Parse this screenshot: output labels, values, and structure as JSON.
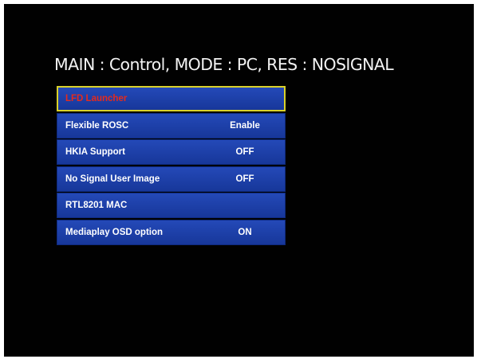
{
  "status": {
    "text": "MAIN : Control, MODE : PC, RES : NOSIGNAL"
  },
  "menu": {
    "items": [
      {
        "label": "LFD Launcher",
        "value": "",
        "selected": true
      },
      {
        "label": "Flexible ROSC",
        "value": "Enable",
        "selected": false
      },
      {
        "label": "HKIA Support",
        "value": "OFF",
        "selected": false
      },
      {
        "label": "No Signal User Image",
        "value": "OFF",
        "selected": false
      },
      {
        "label": "RTL8201 MAC",
        "value": "",
        "selected": false
      },
      {
        "label": "Mediaplay OSD option",
        "value": "ON",
        "selected": false
      }
    ]
  },
  "colors": {
    "background": "#010101",
    "menu_blue": "#1b3fa6",
    "highlight_border": "#d9d12a",
    "selected_text": "#e62a1c",
    "text": "#ffffff"
  }
}
